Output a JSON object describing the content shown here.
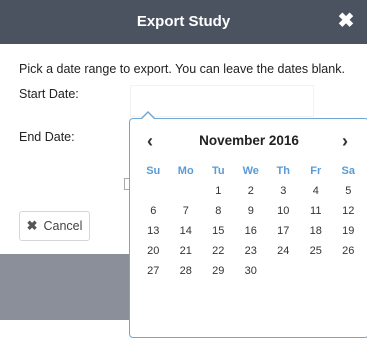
{
  "dialog": {
    "title": "Export Study",
    "close_glyph": "✖",
    "instructions": "Pick a date range to export. You can leave the dates blank.",
    "start_label": "Start Date:",
    "end_label": "End Date:",
    "start_value": "",
    "cancel_label": "Cancel",
    "cancel_icon": "x-icon"
  },
  "calendar": {
    "month_label": "November 2016",
    "prev_glyph": "‹",
    "next_glyph": "›",
    "weekdays": [
      "Su",
      "Mo",
      "Tu",
      "We",
      "Th",
      "Fr",
      "Sa"
    ],
    "weeks": [
      [
        "",
        "",
        "1",
        "2",
        "3",
        "4",
        "5"
      ],
      [
        "6",
        "7",
        "8",
        "9",
        "10",
        "11",
        "12"
      ],
      [
        "13",
        "14",
        "15",
        "16",
        "17",
        "18",
        "19"
      ],
      [
        "20",
        "21",
        "22",
        "23",
        "24",
        "25",
        "26"
      ],
      [
        "27",
        "28",
        "29",
        "30",
        "",
        "",
        ""
      ]
    ],
    "accent_color": "#5b9bd5"
  }
}
